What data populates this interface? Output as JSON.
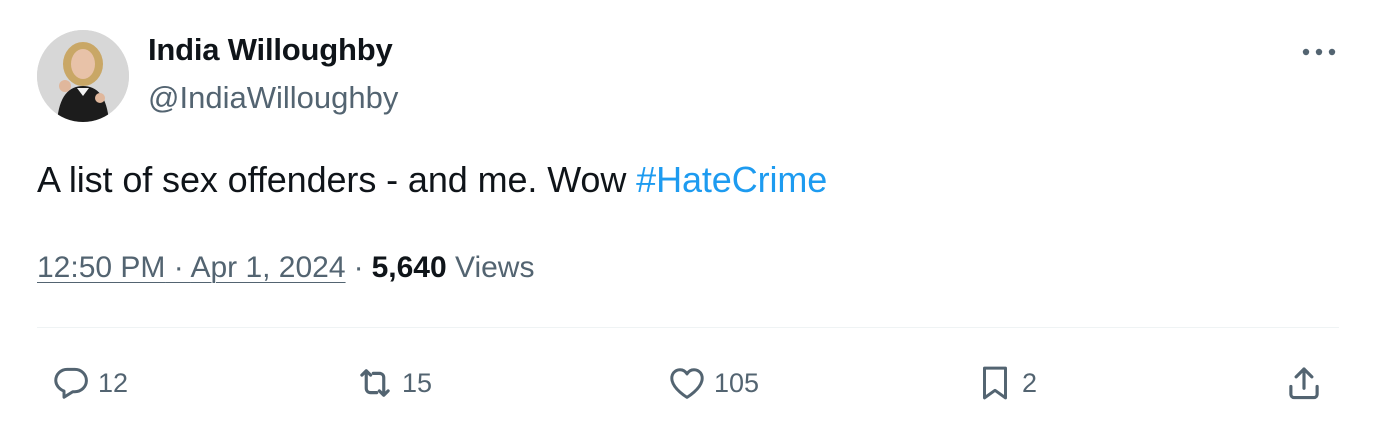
{
  "author": {
    "display_name": "India Willoughby",
    "handle": "@IndiaWilloughby"
  },
  "tweet": {
    "text": "A list of sex offenders - and me. Wow ",
    "hashtag": "#HateCrime",
    "time": "12:50 PM",
    "date": "Apr 1, 2024",
    "views_count": "5,640",
    "views_label": "Views"
  },
  "actions": {
    "replies": "12",
    "retweets": "15",
    "likes": "105",
    "bookmarks": "2"
  },
  "icons": {
    "more": "more-horizontal-icon",
    "reply": "reply-bubble-icon",
    "retweet": "retweet-arrows-icon",
    "like": "heart-icon",
    "bookmark": "bookmark-icon",
    "share": "share-upload-icon"
  },
  "colors": {
    "text": "#0f1419",
    "secondary": "#536471",
    "link": "#1d9bf0",
    "divider": "#eff3f4"
  }
}
